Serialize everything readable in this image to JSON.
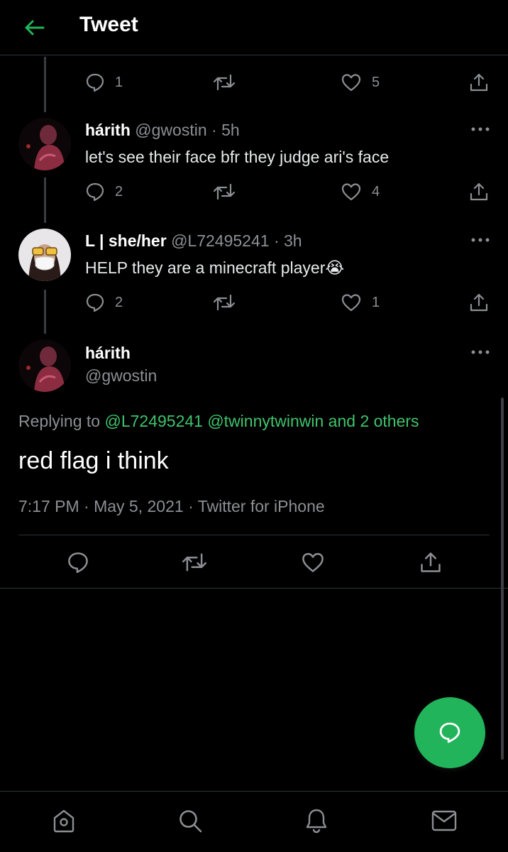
{
  "header": {
    "title": "Tweet"
  },
  "colors": {
    "accent": "#21b45a",
    "link": "#3fc36c",
    "muted": "#8b8f94",
    "background": "#000000"
  },
  "icons": {
    "back": "arrow-left-icon",
    "reply": "speech-bubble-icon",
    "retweet": "retweet-icon",
    "like": "heart-icon",
    "share": "share-icon",
    "more": "more-dots-icon",
    "compose": "compose-reply-icon",
    "home": "home-icon",
    "search": "search-icon",
    "notifications": "bell-icon",
    "messages": "envelope-icon"
  },
  "thread": {
    "parent_actions": {
      "replies": "1",
      "retweets": "",
      "likes": "5"
    },
    "tweets": [
      {
        "name": "hárith",
        "handle": "@gwostin",
        "time": "· 5h",
        "text": "let's see their face bfr they judge ari's face",
        "actions": {
          "replies": "2",
          "retweets": "",
          "likes": "4"
        }
      },
      {
        "name": "L | she/her",
        "handle": "@L72495241",
        "time": "· 3h",
        "text": "HELP they are a minecraft player😭",
        "actions": {
          "replies": "2",
          "retweets": "",
          "likes": "1"
        }
      }
    ]
  },
  "main_tweet": {
    "name": "hárith",
    "handle": "@gwostin",
    "replying_prefix": "Replying to",
    "replying_mentions": "@L72495241 @twinnytwinwin and 2 others",
    "text": "red flag i think",
    "meta": "7:17 PM · May 5, 2021 · Twitter for iPhone"
  }
}
